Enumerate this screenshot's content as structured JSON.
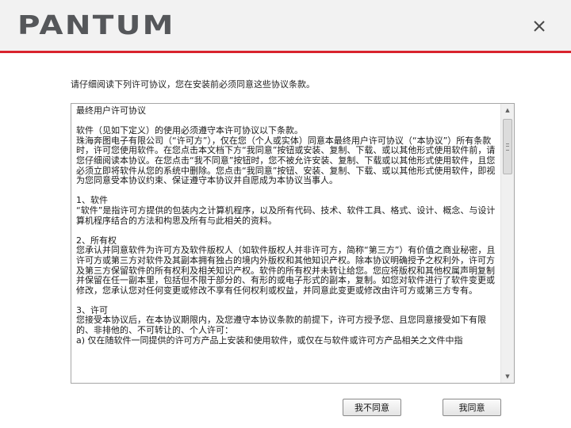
{
  "header": {
    "logo_text": "PANTUM",
    "close_icon": "close-icon",
    "accent_color": "#d9232d"
  },
  "intro_text": "请仔细阅读下列许可协议，您在安装前必须同意这些协议条款。",
  "agreement": {
    "paragraphs": [
      "最终用户许可协议",
      "软件（见如下定义）的使用必须遵守本许可协议以下条款。\n珠海奔图电子有限公司（“许可方”），仅在您（个人或实体）同意本最终用户许可协议（“本协议”）所有条款时，许可您使用软件。在您点击本文档下方“我同意”按钮或安装、复制、下载、或以其他形式使用软件前，请您仔细阅读本协议。在您点击“我不同意”按钮时，您不被允许安装、复制、下载或以其他形式使用软件，且您必须立即将软件从您的系统中删除。您点击“我同意”按钮、安装、复制、下载、或以其他形式使用软件，即视为您同意受本协议约束、保证遵守本协议并自愿成为本协议当事人。",
      "1、软件\n“软件”是指许可方提供的包装内之计算机程序，以及所有代码、技术、软件工具、格式、设计、概念、与设计算机程序结合的方法和构思及所有与此相关的资料。",
      "2、所有权\n您承认并同意软件为许可方及软件版权人（如软件版权人并非许可方，简称“第三方”）有价值之商业秘密，且许可方或第三方对软件及其副本拥有独占的境内外版权和其他知识产权。除本协议明确授予之权利外，许可方及第三方保留软件的所有权利及相关知识产权。软件的所有权并未转让给您。您应将版权和其他权属声明复制并保留在任一副本里，包括但不限于部分的、有形的或电子形式的副本，复制。如您对软件进行了软件变更或修改，您承认您对任何变更或修改不享有任何权利或权益，并同意此变更或修改由许可方或第三方专有。",
      "3、许可\n您接受本协议后，在本协议期限内，及您遵守本协议条款的前提下，许可方授予您、且您同意接受如下有限的、非排他的、不可转让的、个人许可：\na) 仅在随软件一同提供的许可方产品上安装和使用软件，或仅在与软件或许可方产品相关之文件中指"
    ]
  },
  "buttons": {
    "decline": "我不同意",
    "accept": "我同意"
  }
}
